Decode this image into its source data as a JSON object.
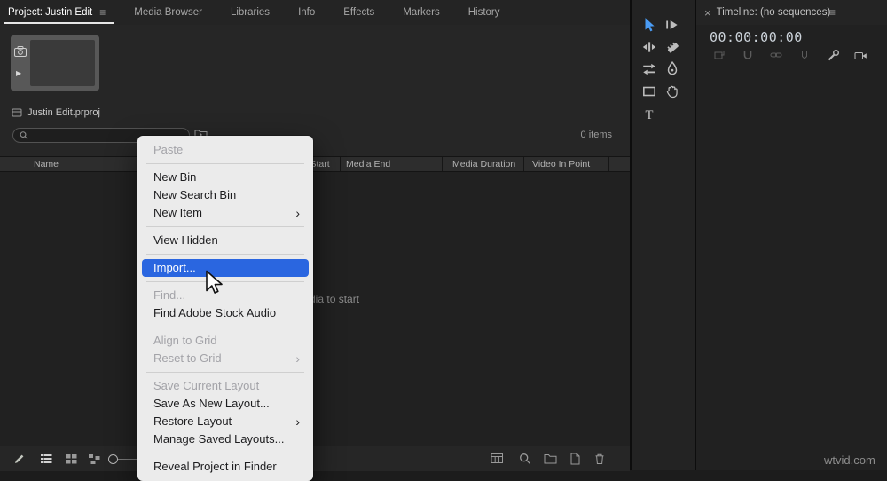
{
  "colors": {
    "menu_highlight": "#2a66e0",
    "tool_active_blue": "#4a9cf5",
    "panel_bg": "#262626",
    "menu_bg": "#ebebeb"
  },
  "icons": {
    "panel_menu": "≡",
    "close": "×",
    "submenu_chevron": "›",
    "play": "▶"
  },
  "tabs": [
    {
      "label": "Project: Justin Edit",
      "active": true
    },
    {
      "label": "Media Browser",
      "active": false
    },
    {
      "label": "Libraries",
      "active": false
    },
    {
      "label": "Info",
      "active": false
    },
    {
      "label": "Effects",
      "active": false
    },
    {
      "label": "Markers",
      "active": false
    },
    {
      "label": "History",
      "active": false
    }
  ],
  "project": {
    "filename": "Justin Edit.prproj",
    "items_count": "0 items",
    "empty_hint": "Import media to start",
    "search_placeholder": "",
    "columns": [
      "Name",
      "Media Start",
      "Media End",
      "Media Duration",
      "Video In Point"
    ]
  },
  "context_menu": {
    "items": [
      {
        "label": "Paste",
        "state": "disabled",
        "submenu": false
      },
      {
        "label": "New Bin",
        "state": "normal",
        "submenu": false
      },
      {
        "label": "New Search Bin",
        "state": "normal",
        "submenu": false
      },
      {
        "label": "New Item",
        "state": "normal",
        "submenu": true
      },
      {
        "label": "View Hidden",
        "state": "normal",
        "submenu": false
      },
      {
        "label": "Import...",
        "state": "highlighted",
        "submenu": false
      },
      {
        "label": "Find...",
        "state": "disabled",
        "submenu": false
      },
      {
        "label": "Find Adobe Stock Audio",
        "state": "normal",
        "submenu": false
      },
      {
        "label": "Align to Grid",
        "state": "disabled",
        "submenu": false
      },
      {
        "label": "Reset to Grid",
        "state": "disabled",
        "submenu": true
      },
      {
        "label": "Save Current Layout",
        "state": "disabled",
        "submenu": false
      },
      {
        "label": "Save As New Layout...",
        "state": "normal",
        "submenu": false
      },
      {
        "label": "Restore Layout",
        "state": "normal",
        "submenu": true
      },
      {
        "label": "Manage Saved Layouts...",
        "state": "normal",
        "submenu": false
      },
      {
        "label": "Reveal Project in Finder",
        "state": "normal",
        "submenu": false
      }
    ]
  },
  "timeline": {
    "title": "Timeline: (no sequences)",
    "timecode": "00:00:00:00"
  },
  "watermark": "wtvid.com"
}
